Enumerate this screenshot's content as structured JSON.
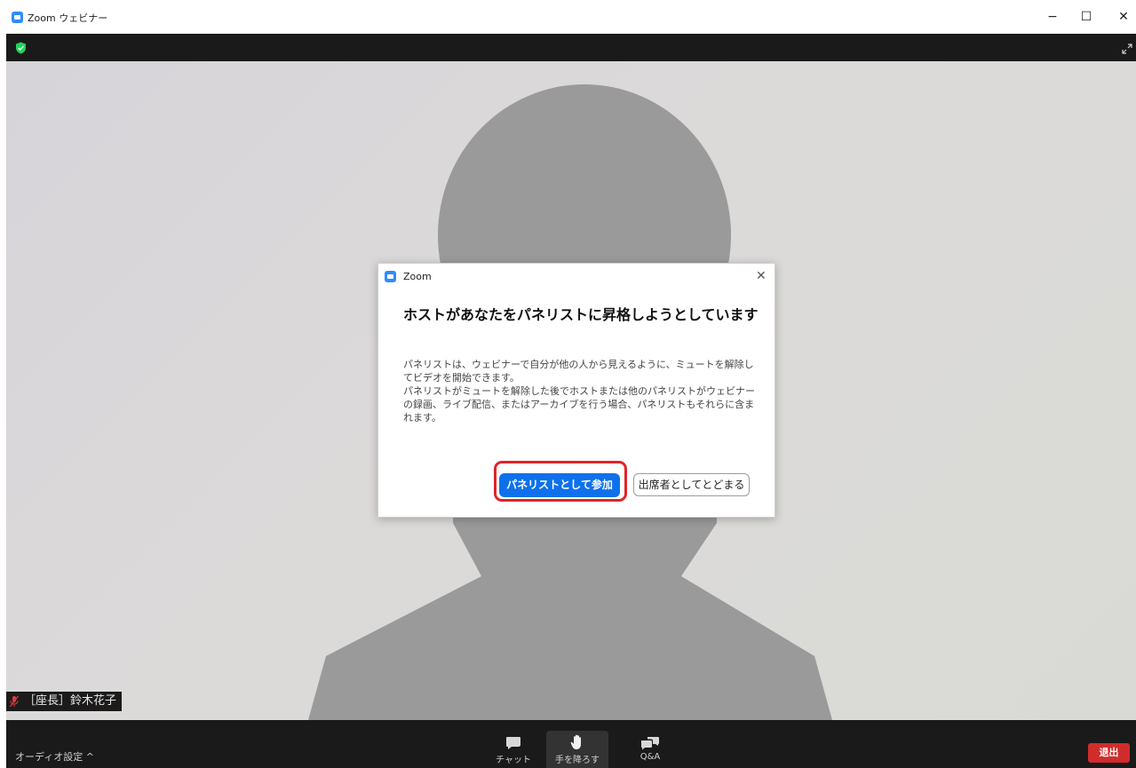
{
  "window": {
    "title": "Zoom ウェビナー",
    "min_glyph": "−",
    "max_glyph": "☐",
    "close_glyph": "✕"
  },
  "participant": {
    "name_label": "［座長］鈴木花子"
  },
  "toolbar": {
    "audio_settings_label": "オーディオ設定 ^",
    "chat_label": "チャット",
    "hand_label": "手を降ろす",
    "qa_label": "Q&A",
    "leave_label": "退出"
  },
  "dialog": {
    "app_name": "Zoom",
    "close_glyph": "✕",
    "heading": "ホストがあなたをパネリストに昇格しようとしています",
    "body_line1": "パネリストは、ウェビナーで自分が他の人から見えるように、ミュートを解除してビデオを開始できます。",
    "body_line2": "パネリストがミュートを解除した後でホストまたは他のパネリストがウェビナーの録画、ライブ配信、またはアーカイブを行う場合、パネリストもそれらに含まれます。",
    "join_button": "パネリストとして参加",
    "stay_button": "出席者としてとどまる"
  },
  "colors": {
    "accent": "#2D8CFF",
    "primary_button": "#0e71eb",
    "highlight": "#e0242a",
    "leave": "#d12c2c",
    "security_green": "#23d35a"
  },
  "icons": {
    "security": "shield-check-icon",
    "fullscreen": "expand-icon",
    "muted_mic": "mic-muted-icon",
    "chat": "chat-bubble-icon",
    "hand": "raised-hand-icon",
    "qa": "qa-bubbles-icon"
  }
}
